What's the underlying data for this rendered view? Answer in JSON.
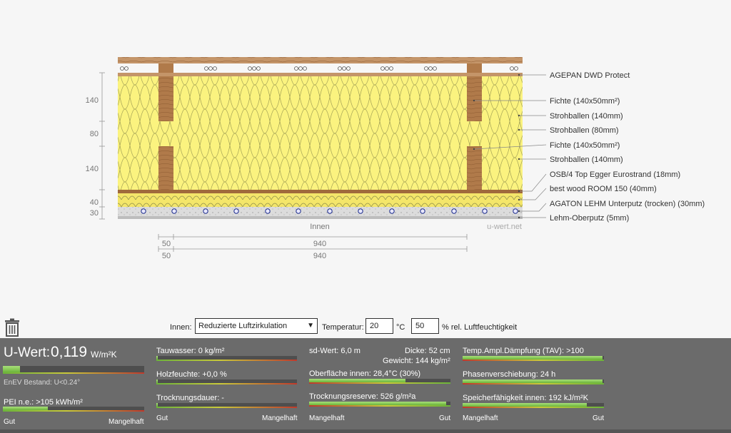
{
  "diagram": {
    "layers": [
      "AGEPAN DWD Protect",
      "Fichte (140x50mm²)",
      "Strohballen (140mm)",
      "Strohballen (80mm)",
      "Fichte (140x50mm²)",
      "Strohballen (140mm)",
      "OSB/4 Top Egger Eurostrand (18mm)",
      "best wood ROOM 150 (40mm)",
      "AGATON LEHM Unterputz (trocken) (30mm)",
      "Lehm-Oberputz (5mm)"
    ],
    "thickness_labels": [
      "140",
      "80",
      "140",
      "40",
      "30"
    ],
    "inside_label": "Innen",
    "watermark": "u-wert.net",
    "horizontal_dims": {
      "row1": [
        "50",
        "940"
      ],
      "row2": [
        "50",
        "940"
      ]
    }
  },
  "controls": {
    "inside_label": "Innen:",
    "selected_option": "Reduzierte Luftzirkulation",
    "temperature_label": "Temperatur:",
    "temperature_value": "20",
    "temperature_unit": "°C",
    "humidity_value": "50",
    "humidity_unit": "% rel. Luftfeuchtigkeit"
  },
  "results": {
    "uwert": {
      "label": "U-Wert:",
      "value": "0,119",
      "unit": "W/m²K",
      "enev": "EnEV Bestand: U<0.24°",
      "fill": 0.12
    },
    "pei": {
      "text": "PEI n.e.: >105 kWh/m²",
      "fill": 0.32
    },
    "col1": [
      {
        "text": "Tauwasser: 0 kg/m²",
        "fill": 0.01
      },
      {
        "text": "Holzfeuchte: +0,0 %",
        "fill": 0.01
      },
      {
        "text": "Trocknungsdauer: -",
        "fill": 0.01
      }
    ],
    "col2": {
      "sd": "sd-Wert: 6,0 m",
      "dicke": "Dicke: 52 cm",
      "gewicht": "Gewicht: 144 kg/m²",
      "oberflaeche": {
        "text": "Oberfläche innen: 28,4°C (30%)",
        "fill": 0.68
      },
      "trocknungsreserve": {
        "text": "Trocknungsreserve: 526 g/m²a",
        "fill": 0.97
      }
    },
    "col3": [
      {
        "text": "Temp.Ampl.Dämpfung (TAV): >100",
        "fill": 0.99
      },
      {
        "text": "Phasenverschiebung: 24 h",
        "fill": 0.99
      },
      {
        "text": "Speicherfähigkeit innen: 192 kJ/m²K",
        "fill": 0.88
      }
    ],
    "scale": {
      "gut": "Gut",
      "mangelhaft": "Mangelhaft"
    }
  },
  "colors": {
    "wood": "#b07a4a",
    "insulation": "#fbf37f",
    "accent_green": "#6cb43a"
  }
}
